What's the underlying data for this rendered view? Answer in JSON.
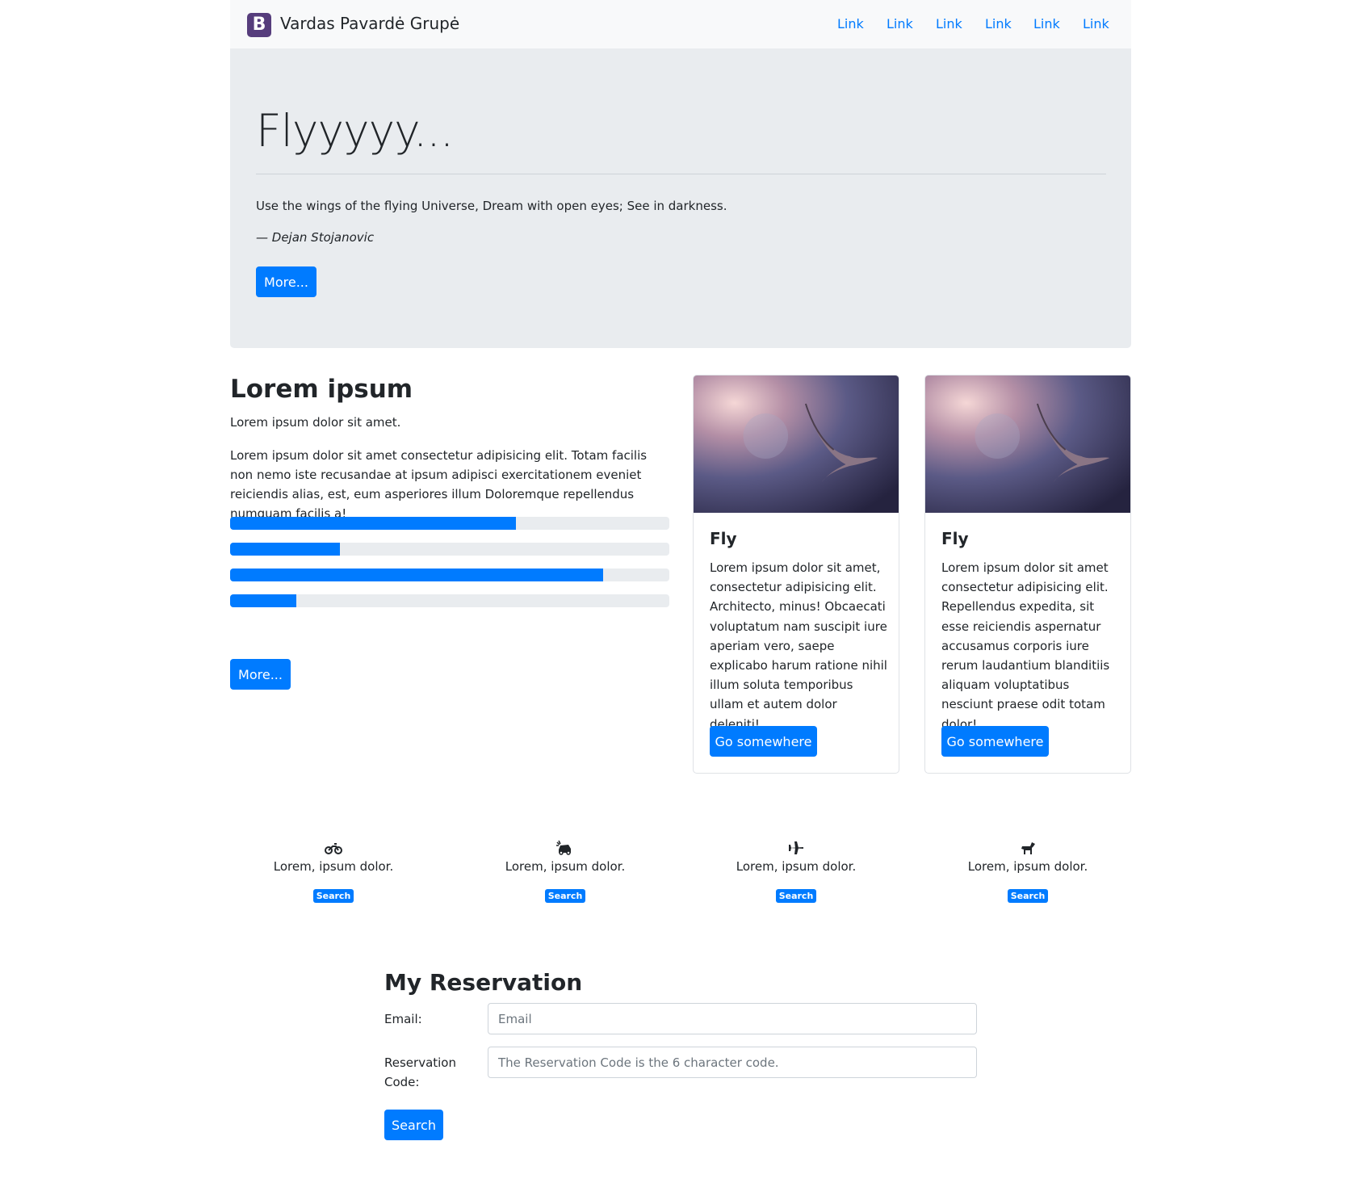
{
  "navbar": {
    "brand_logo": "B",
    "brand_text": "Vardas Pavardė Grupė",
    "links": [
      "Link",
      "Link",
      "Link",
      "Link",
      "Link",
      "Link"
    ]
  },
  "jumbotron": {
    "title": "Flyyyyy...",
    "quote": "Use the wings of the flying Universe, Dream with open eyes; See in darkness.",
    "author": "— Dejan Stojanovic",
    "button": "More..."
  },
  "lorem": {
    "title": "Lorem ipsum",
    "subtitle": "Lorem ipsum dolor sit amet.",
    "paragraph": "Lorem ipsum dolor sit amet consectetur adipisicing elit. Totam facilis non nemo iste recusandae at ipsum adipisci exercitationem eveniet reiciendis alias, est, eum asperiores illum Doloremque repellendus numquam facilis a!",
    "progress": [
      0.65,
      0.25,
      0.85,
      0.15
    ],
    "button": "More..."
  },
  "cards": [
    {
      "title": "Fly",
      "text": "Lorem ipsum dolor sit amet, consectetur adipisicing elit. Architecto, minus! Obcaecati voluptatum nam suscipit iure aperiam vero, saepe explicabo harum ratione nihil illum soluta temporibus ullam et autem dolor deleniti!",
      "button": "Go somewhere"
    },
    {
      "title": "Fly",
      "text": "Lorem ipsum dolor sit amet consectetur adipisicing elit. Repellendus expedita, sit esse reiciendis aspernatur accusamus corporis iure rerum laudantium blanditiis aliquam voluptatibus nesciunt praese odit totam dolor!",
      "button": "Go somewhere"
    }
  ],
  "features": [
    {
      "icon": "motorcycle-icon",
      "text": "Lorem, ipsum dolor.",
      "button": "Search"
    },
    {
      "icon": "car-crash-icon",
      "text": "Lorem, ipsum dolor.",
      "button": "Search"
    },
    {
      "icon": "plane-icon",
      "text": "Lorem, ipsum dolor.",
      "button": "Search"
    },
    {
      "icon": "horse-icon",
      "text": "Lorem, ipsum dolor.",
      "button": "Search"
    }
  ],
  "reservation": {
    "title": "My Reservation",
    "email_label": "Email:",
    "email_placeholder": "Email",
    "code_label_line1": "Reservation",
    "code_label_line2": "Code:",
    "code_placeholder": "The Reservation Code is the 6 character code.",
    "button": "Search"
  },
  "colors": {
    "primary": "#007bff",
    "brand": "#563d7c",
    "jumbotron_bg": "#e9ecef",
    "navbar_bg": "#f8f9fa"
  }
}
